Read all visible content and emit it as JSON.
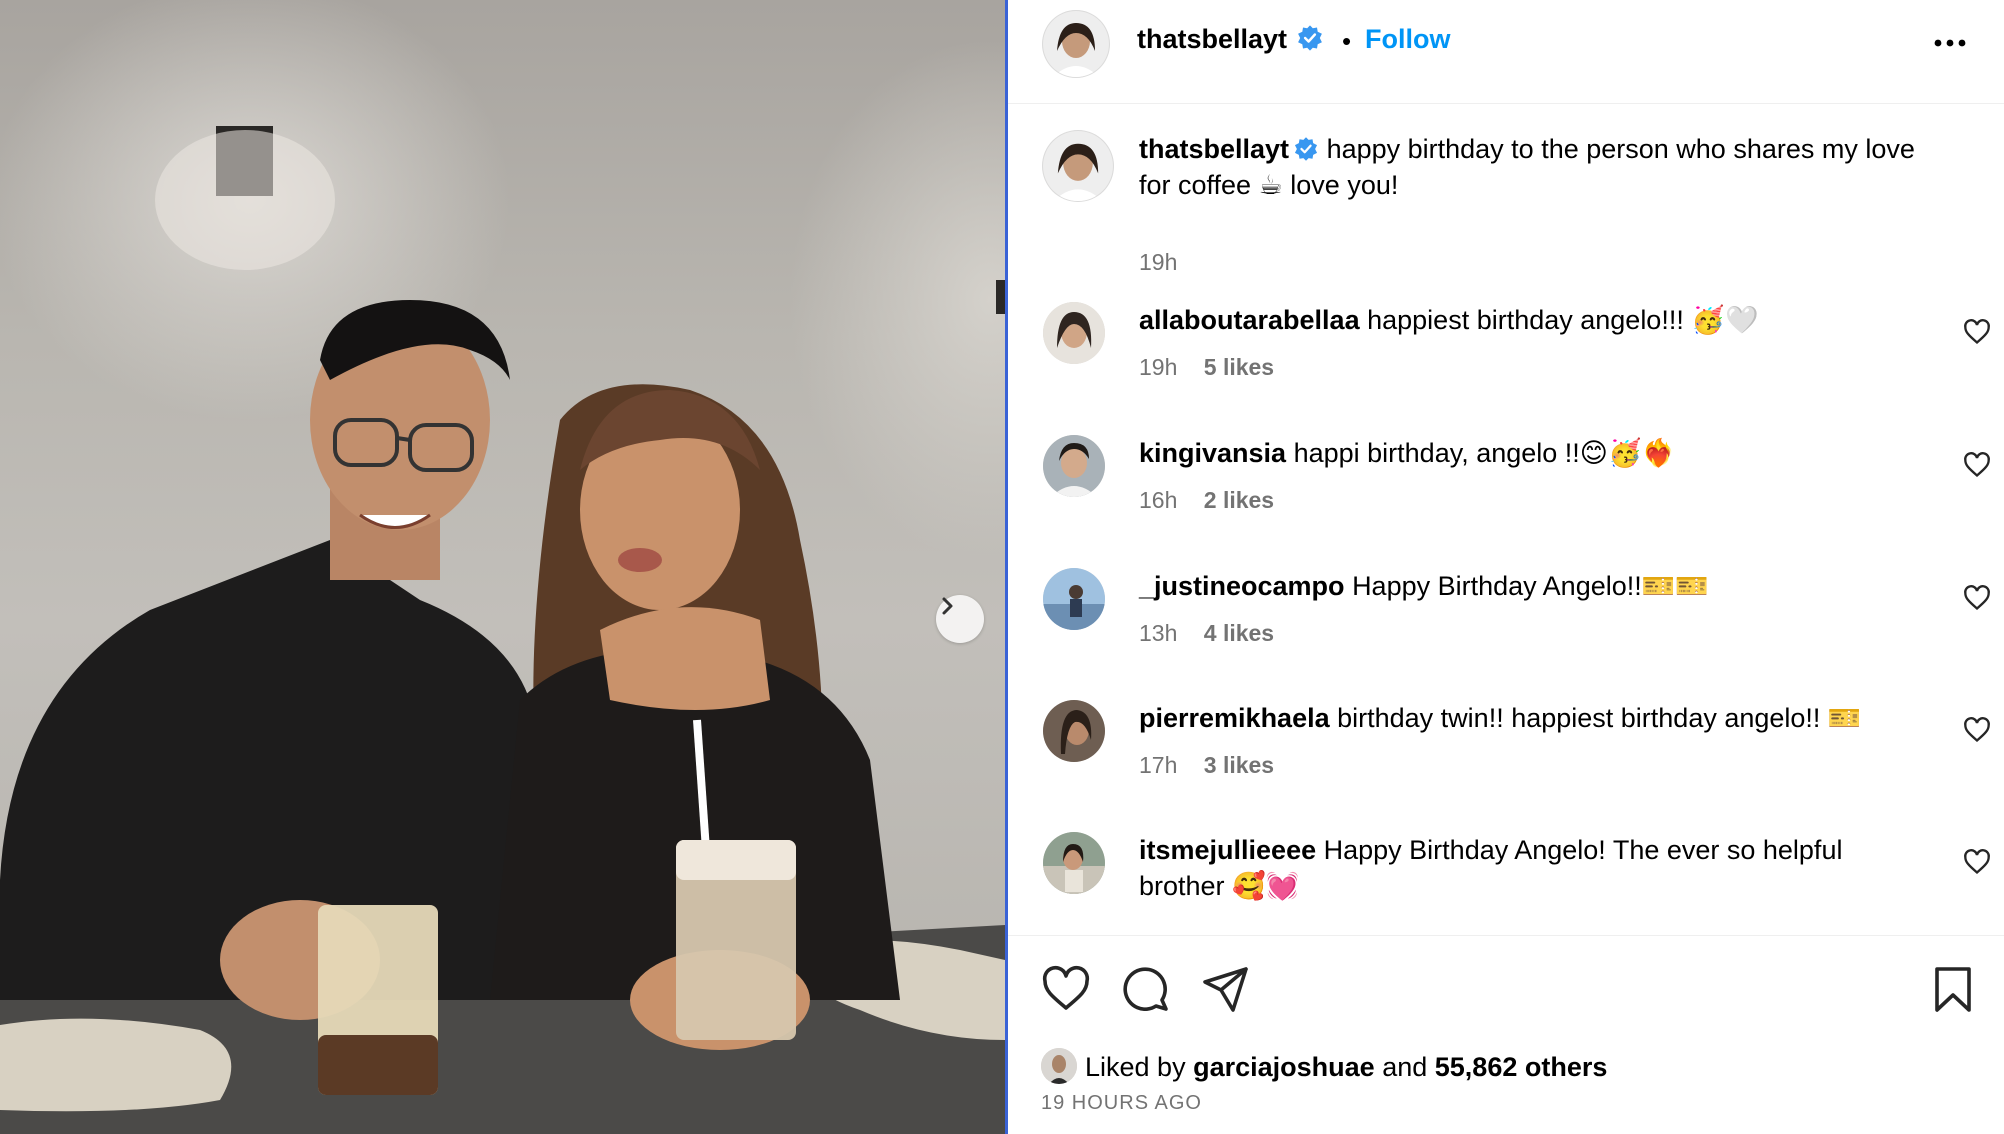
{
  "post": {
    "username": "thatsbellayt",
    "follow_label": "Follow",
    "separator": "•",
    "caption": "happy birthday to the person who shares my love for coffee ☕ love you!",
    "caption_time": "19h"
  },
  "comments": [
    {
      "username": "allaboutarabellaa",
      "text": "happiest birthday angelo!!! 🥳🤍",
      "time": "19h",
      "likes": "5 likes"
    },
    {
      "username": "kingivansia",
      "text": "happi birthday, angelo !!😊🥳❤️‍🔥",
      "time": "16h",
      "likes": "2 likes"
    },
    {
      "username": "_justineocampo",
      "text": "Happy Birthday Angelo!!🎫🎫",
      "time": "13h",
      "likes": "4 likes"
    },
    {
      "username": "pierremikhaela",
      "text": "birthday twin!! happiest birthday angelo!! 🎫",
      "time": "17h",
      "likes": "3 likes"
    },
    {
      "username": "itsmejullieeee",
      "text": "Happy Birthday Angelo! The ever so helpful brother 🥰💓",
      "time": "",
      "likes": ""
    }
  ],
  "footer": {
    "liked_by_prefix": "Liked by",
    "liked_by_user": "garciajoshuae",
    "and_label": "and",
    "others_count": "55,862 others",
    "timestamp": "19 HOURS AGO"
  },
  "icons": {
    "verified": "verified-badge-icon",
    "more": "more-options-icon",
    "next": "chevron-right-icon",
    "like": "heart-icon",
    "comment": "comment-bubble-icon",
    "share": "paper-plane-icon",
    "save": "bookmark-icon"
  },
  "colors": {
    "accent": "#0095f6",
    "verified": "#3897f0",
    "muted": "#737373",
    "divider": "#3a63d6"
  }
}
